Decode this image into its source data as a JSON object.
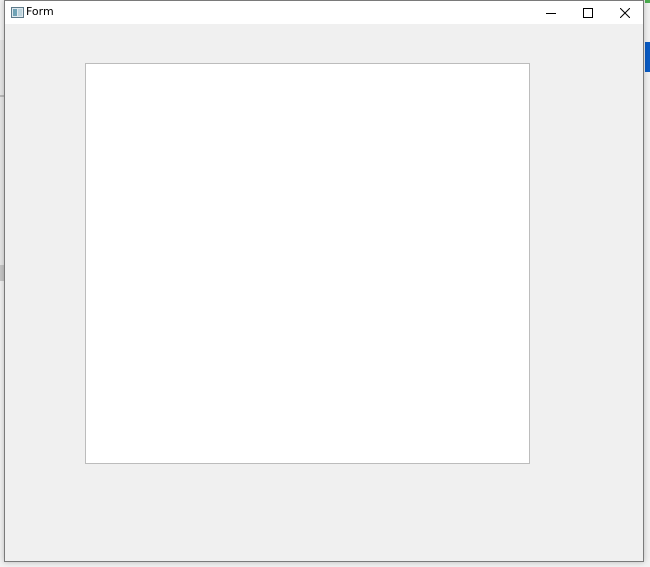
{
  "window": {
    "title": "Form",
    "icon": "qt-form-icon"
  },
  "titlebar_buttons": {
    "minimize": "minimize-icon",
    "maximize": "maximize-icon",
    "close": "close-icon"
  },
  "colors": {
    "window_bg": "#f0f0f0",
    "titlebar_bg": "#ffffff",
    "canvas_bg": "#ffffff",
    "canvas_border": "#bcbcbc"
  }
}
